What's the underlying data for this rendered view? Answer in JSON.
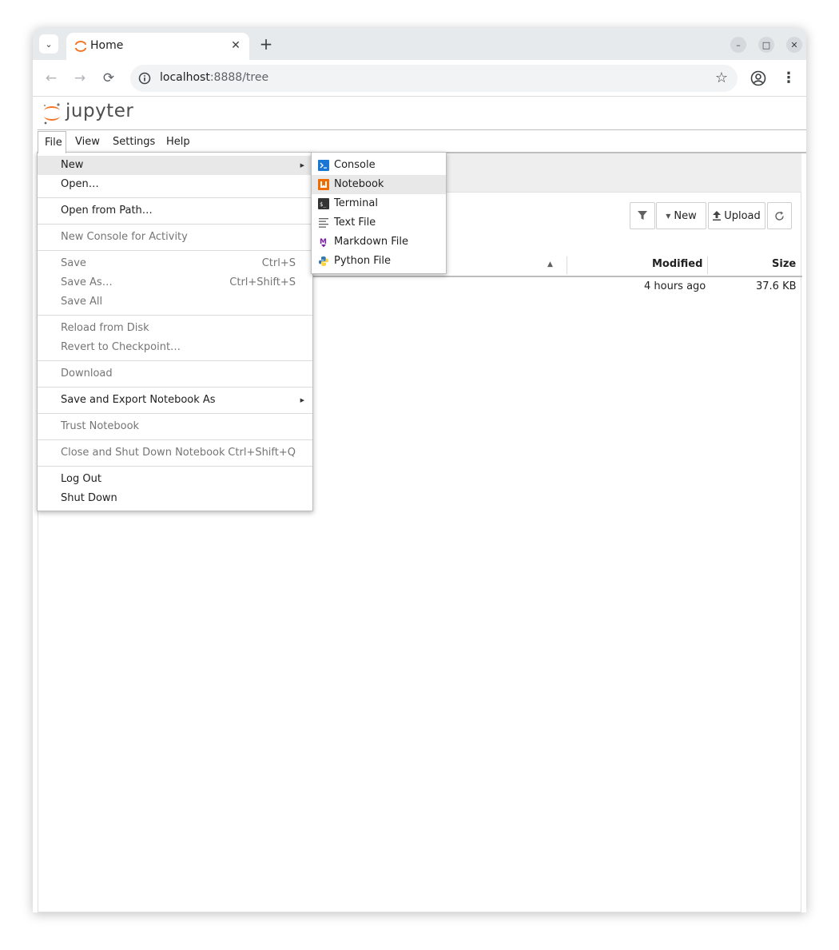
{
  "browser": {
    "tab_title": "Home",
    "url_host": "localhost",
    "url_rest": ":8888/tree",
    "new_tab_symbol": "+",
    "back_icon": "←",
    "forward_icon": "→",
    "reload_icon": "⟳",
    "close_tab_symbol": "✕",
    "star_icon": "☆",
    "kebab_icon": "⋮",
    "tab_dropdown_icon": "⌄",
    "minimize_icon": "–",
    "maximize_icon": "□",
    "close_window_icon": "✕"
  },
  "jupyter": {
    "logo_text": "jupyter",
    "accent_color": "#f37726",
    "menubar": [
      "File",
      "View",
      "Settings",
      "Help"
    ]
  },
  "file_menu": {
    "items": [
      {
        "label": "New",
        "shortcut": "",
        "disabled": false,
        "submenu": true,
        "active": true
      },
      {
        "label": "Open…",
        "shortcut": "",
        "disabled": false
      },
      {
        "label": "Open from Path…",
        "shortcut": "",
        "disabled": false
      },
      {
        "label": "New Console for Activity",
        "shortcut": "",
        "disabled": true
      },
      {
        "label": "Save",
        "shortcut": "Ctrl+S",
        "disabled": true
      },
      {
        "label": "Save As…",
        "shortcut": "Ctrl+Shift+S",
        "disabled": true
      },
      {
        "label": "Save All",
        "shortcut": "",
        "disabled": true
      },
      {
        "label": "Reload from Disk",
        "shortcut": "",
        "disabled": true
      },
      {
        "label": "Revert to Checkpoint…",
        "shortcut": "",
        "disabled": true
      },
      {
        "label": "Download",
        "shortcut": "",
        "disabled": true
      },
      {
        "label": "Save and Export Notebook As",
        "shortcut": "",
        "disabled": false,
        "submenu": true
      },
      {
        "label": "Trust Notebook",
        "shortcut": "",
        "disabled": true
      },
      {
        "label": "Close and Shut Down Notebook",
        "shortcut": "Ctrl+Shift+Q",
        "disabled": true
      },
      {
        "label": "Log Out",
        "shortcut": "",
        "disabled": false
      },
      {
        "label": "Shut Down",
        "shortcut": "",
        "disabled": false
      }
    ]
  },
  "new_submenu": {
    "items": [
      {
        "label": "Console",
        "icon": "console-icon"
      },
      {
        "label": "Notebook",
        "icon": "notebook-icon"
      },
      {
        "label": "Terminal",
        "icon": "terminal-icon"
      },
      {
        "label": "Text File",
        "icon": "text-file-icon"
      },
      {
        "label": "Markdown File",
        "icon": "markdown-icon"
      },
      {
        "label": "Python File",
        "icon": "python-icon"
      }
    ],
    "hovered_index": 1
  },
  "file_browser": {
    "toolbar": {
      "filter_icon": "filter-icon",
      "new_label": "New",
      "upload_label": "Upload",
      "refresh_icon": "refresh-icon"
    },
    "columns": {
      "name": "",
      "modified": "Modified",
      "size": "Size"
    },
    "rows": [
      {
        "modified": "4 hours ago",
        "size": "37.6 KB"
      }
    ]
  }
}
